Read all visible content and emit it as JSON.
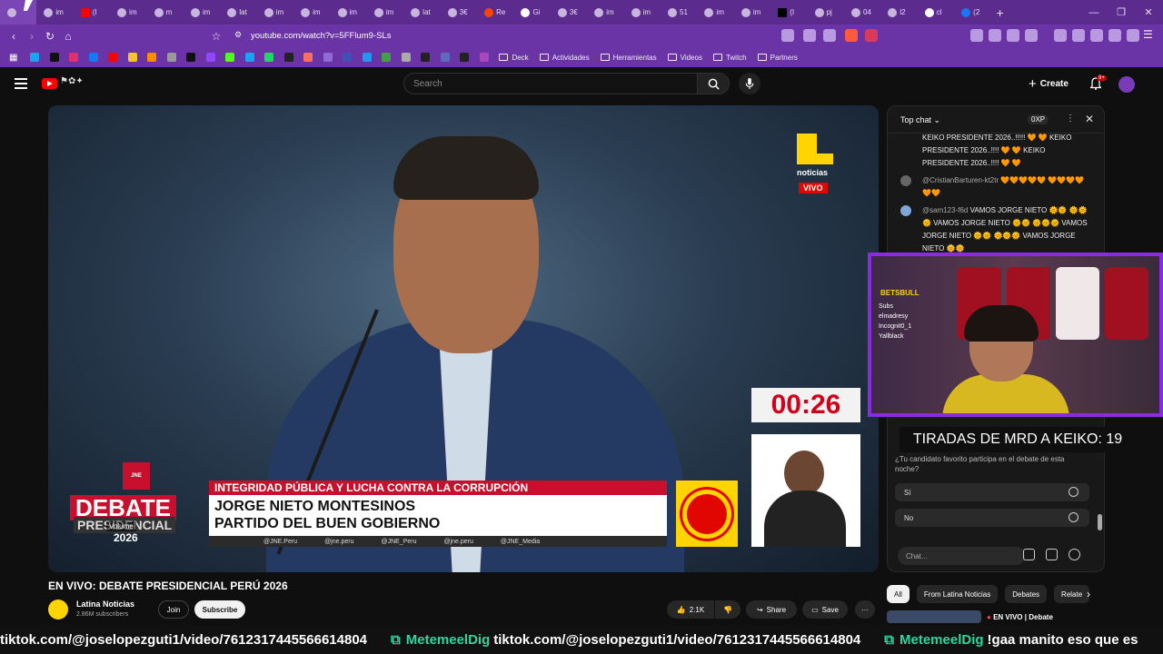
{
  "browser": {
    "tabs": [
      {
        "label": "",
        "icon": "purple-icon",
        "active": true
      },
      {
        "label": "im",
        "icon": "globe-icon"
      },
      {
        "label": "(I",
        "icon": "youtube-icon"
      },
      {
        "label": "im",
        "icon": "globe-icon"
      },
      {
        "label": "m",
        "icon": "globe-icon"
      },
      {
        "label": "im",
        "icon": "globe-icon"
      },
      {
        "label": "lat",
        "icon": "globe-icon"
      },
      {
        "label": "im",
        "icon": "globe-icon"
      },
      {
        "label": "im",
        "icon": "globe-icon"
      },
      {
        "label": "im",
        "icon": "globe-icon"
      },
      {
        "label": "im",
        "icon": "globe-icon"
      },
      {
        "label": "lat",
        "icon": "globe-icon"
      },
      {
        "label": "3€",
        "icon": "globe-icon"
      },
      {
        "label": "Re",
        "icon": "reddit-icon"
      },
      {
        "label": "Gi",
        "icon": "google-icon"
      },
      {
        "label": "3€",
        "icon": "globe-icon"
      },
      {
        "label": "im",
        "icon": "globe-icon"
      },
      {
        "label": "im",
        "icon": "globe-icon"
      },
      {
        "label": "51",
        "icon": "globe-icon"
      },
      {
        "label": "im",
        "icon": "globe-icon"
      },
      {
        "label": "im",
        "icon": "globe-icon"
      },
      {
        "label": "(I",
        "icon": "x-icon"
      },
      {
        "label": "pj",
        "icon": "globe-icon"
      },
      {
        "label": "04",
        "icon": "globe-icon"
      },
      {
        "label": "l2",
        "icon": "globe-icon"
      },
      {
        "label": "cl",
        "icon": "google-icon"
      },
      {
        "label": "(2",
        "icon": "facebook-icon"
      }
    ],
    "new_tab": "+",
    "url": "youtube.com/watch?v=5FFlum9-SLs",
    "bookmarks_folders": [
      "Deck",
      "Actividades",
      "Herramientas",
      "Videos",
      "Twitch",
      "Partners"
    ]
  },
  "youtube": {
    "search_placeholder": "Search",
    "create_label": "Create",
    "notif_badge": "9+",
    "video": {
      "channel_logo_text": "noticias",
      "live_badge": "VIVO",
      "timer": "00:26",
      "debate_logo": {
        "emblem": "JNE",
        "word1": "DEBATE",
        "word2": "PRESIDENCIAL",
        "year": "2026"
      },
      "volume_tooltip": "Volume",
      "lower_third": {
        "topic": "INTEGRIDAD PÚBLICA Y LUCHA CONTRA LA CORRUPCIÓN",
        "name": "JORGE NIETO MONTESINOS",
        "party": "PARTIDO DEL BUEN GOBIERNO",
        "socials": [
          "@JNE.Peru",
          "@jne.peru",
          "@JNE_Peru",
          "@jne.peru",
          "@JNE_Media"
        ]
      }
    },
    "title": "EN VIVO: DEBATE PRESIDENCIAL PERÚ 2026",
    "channel": {
      "name": "Latina Noticias",
      "subscribers": "2.86M subscribers"
    },
    "join_label": "Join",
    "subscribe_label": "Subscribe",
    "likes": "2.1K",
    "share_label": "Share",
    "save_label": "Save",
    "more_label": "···",
    "chips": [
      "All",
      "From Latina Noticias",
      "Debates",
      "Relate"
    ],
    "recommended_title": "EN VIVO | Debate"
  },
  "chat": {
    "mode": "Top chat",
    "xp": "0XP",
    "messages": [
      {
        "author": "",
        "text": "KEIKO PRESIDENTE 2026..!!!!! 🧡 🧡 KEIKO PRESIDENTE 2026..!!!! 🧡 🧡 KEIKO PRESIDENTE 2026..!!!! 🧡 🧡"
      },
      {
        "author": "@CristianBarturen-kt2tr",
        "text": "🧡🧡🧡🧡🧡 🧡🧡🧡🧡🧡🧡"
      },
      {
        "author": "@sam123-f6d",
        "text": "VAMOS JORGE NIETO 🌞🌞 🌞🌞🌞 VAMOS JORGE NIETO 🌞🌞 🌞🌞🌞 VAMOS JORGE NIETO 🌞🌞 🌞🌞🌞 VAMOS JORGE NIETO 🌞🌞"
      }
    ],
    "poll": {
      "question": "¿Tu candidato favorito participa en el debate de esta noche?",
      "options": [
        "Sí",
        "No"
      ]
    },
    "input_placeholder": "Chat..."
  },
  "stream_overlay": {
    "brand": "BETSBULL",
    "sub_names": [
      "Subs",
      "elmadresy",
      "Incognit0_1",
      "Yallblack"
    ],
    "counter": "TIRADAS DE MRD A KEIKO: 19",
    "ticker": {
      "segment1": "tiktok.com/@joselopezguti1/video/7612317445566614804",
      "badge": "⧉",
      "user": "MetemeelDig",
      "segment2": "tiktok.com/@joselopezguti1/video/7612317445566614804",
      "segment3": "!gaa manito eso que es"
    }
  }
}
